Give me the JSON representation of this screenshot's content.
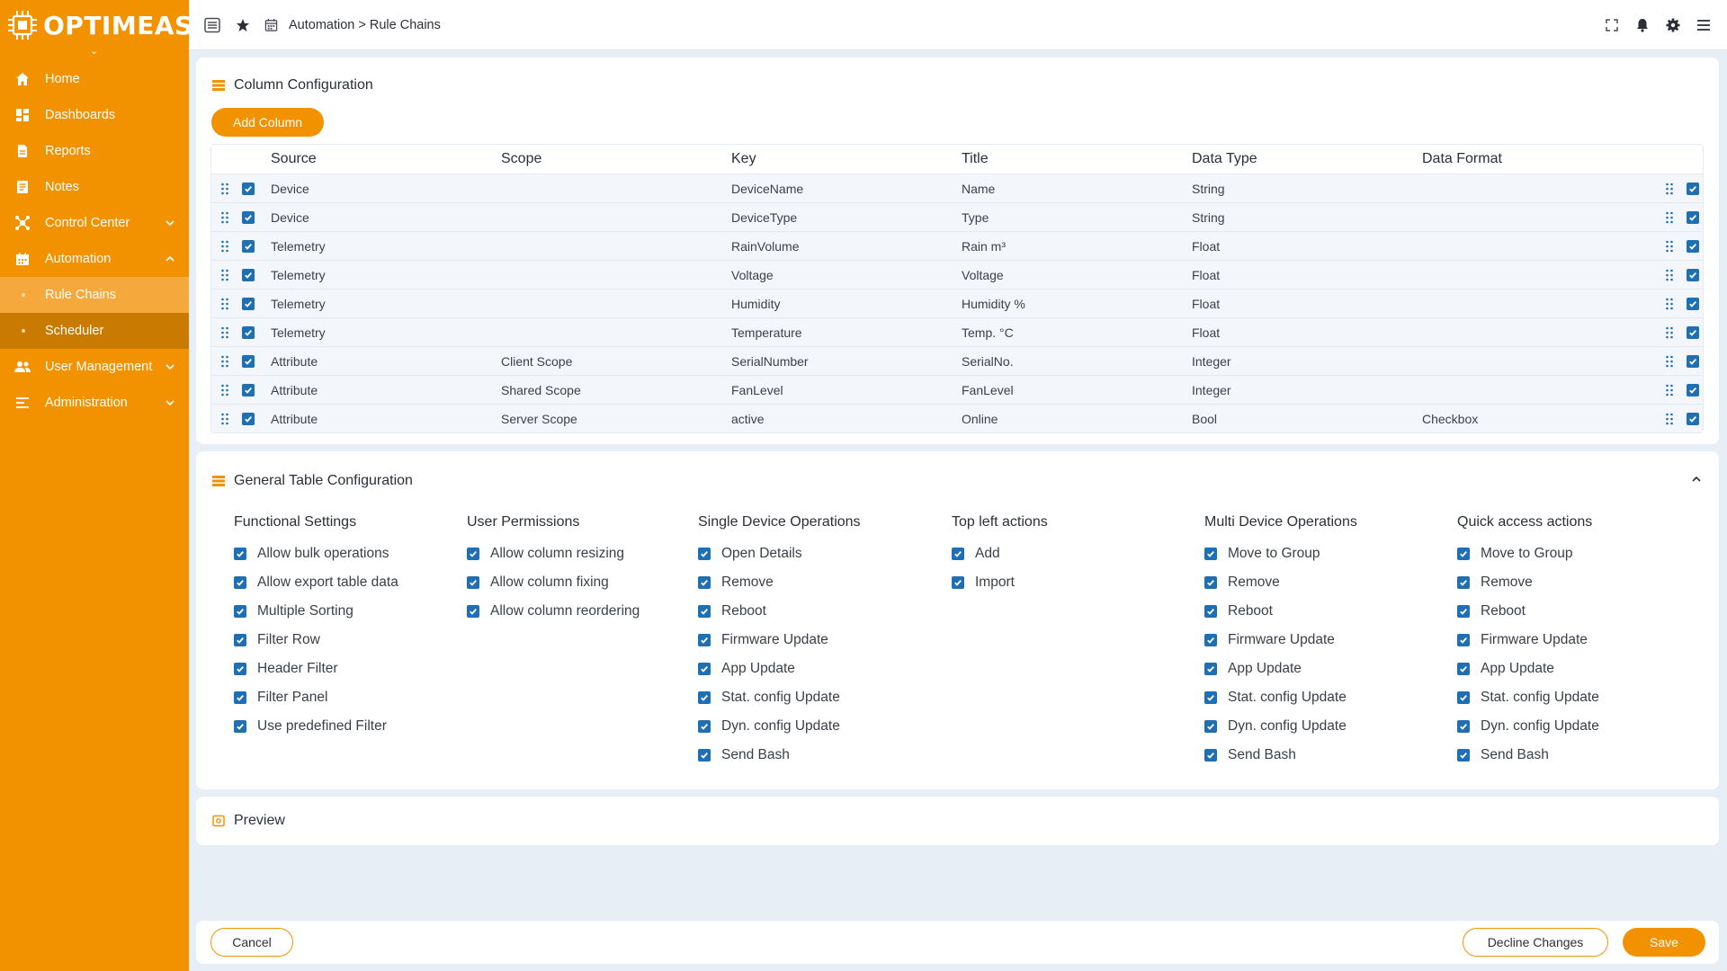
{
  "app": {
    "logo": "OPTIMEAS"
  },
  "sidebar": {
    "items": [
      {
        "label": "Home",
        "icon": "home-icon"
      },
      {
        "label": "Dashboards",
        "icon": "dashboard-icon"
      },
      {
        "label": "Reports",
        "icon": "report-icon"
      },
      {
        "label": "Notes",
        "icon": "note-icon"
      },
      {
        "label": "Control Center",
        "icon": "network-icon"
      },
      {
        "label": "Automation",
        "icon": "calendar-icon"
      },
      {
        "label": "User  Management",
        "icon": "users-icon"
      },
      {
        "label": "Administration",
        "icon": "admin-icon"
      }
    ],
    "sub": [
      {
        "label": "Rule Chains"
      },
      {
        "label": "Scheduler"
      }
    ]
  },
  "header": {
    "breadcrumb": "Automation > Rule Chains"
  },
  "column_config": {
    "title": "Column Configuration",
    "add_label": "Add Column",
    "headers": [
      "Source",
      "Scope",
      "Key",
      "Title",
      "Data Type",
      "Data Format"
    ],
    "rows": [
      [
        "Device",
        "",
        "DeviceName",
        "Name",
        "String",
        ""
      ],
      [
        "Device",
        "",
        "DeviceType",
        "Type",
        "String",
        ""
      ],
      [
        "Telemetry",
        "",
        "RainVolume",
        "Rain m³",
        "Float",
        ""
      ],
      [
        "Telemetry",
        "",
        "Voltage",
        "Voltage",
        "Float",
        ""
      ],
      [
        "Telemetry",
        "",
        "Humidity",
        "Humidity %",
        "Float",
        ""
      ],
      [
        "Telemetry",
        "",
        "Temperature",
        "Temp. °C",
        "Float",
        ""
      ],
      [
        "Attribute",
        "Client Scope",
        "SerialNumber",
        "SerialNo.",
        "Integer",
        ""
      ],
      [
        "Attribute",
        "Shared Scope",
        "FanLevel",
        "FanLevel",
        "Integer",
        ""
      ],
      [
        "Attribute",
        "Server Scope",
        "active",
        "Online",
        "Bool",
        "Checkbox"
      ]
    ]
  },
  "general_config": {
    "title": "General Table Configuration",
    "groups": [
      {
        "title": "Functional Settings",
        "options": [
          "Allow bulk operations",
          "Allow export table data",
          "Multiple Sorting",
          "Filter Row",
          "Header Filter",
          "Filter Panel",
          "Use predefined Filter"
        ]
      },
      {
        "title": "User Permissions",
        "options": [
          "Allow column resizing",
          "Allow column fixing",
          "Allow column reordering"
        ]
      },
      {
        "title": "Single Device Operations",
        "options": [
          "Open Details",
          "Remove",
          "Reboot",
          "Firmware Update",
          "App Update",
          "Stat. config Update",
          "Dyn. config Update",
          "Send Bash"
        ]
      },
      {
        "title": "Top left actions",
        "options": [
          "Add",
          "Import"
        ]
      },
      {
        "title": "Multi Device Operations",
        "options": [
          "Move to Group",
          "Remove",
          "Reboot",
          "Firmware Update",
          "App Update",
          "Stat. config Update",
          "Dyn. config Update",
          "Send Bash"
        ]
      },
      {
        "title": "Quick access actions",
        "options": [
          "Move to Group",
          "Remove",
          "Reboot",
          "Firmware Update",
          "App Update",
          "Stat. config Update",
          "Dyn. config Update",
          "Send Bash"
        ]
      }
    ]
  },
  "preview": {
    "title": "Preview"
  },
  "footer": {
    "cancel": "Cancel",
    "decline": "Decline Changes",
    "save": "Save"
  },
  "colors": {
    "brand": "#f39200",
    "checkbox": "#1f6fb5"
  }
}
